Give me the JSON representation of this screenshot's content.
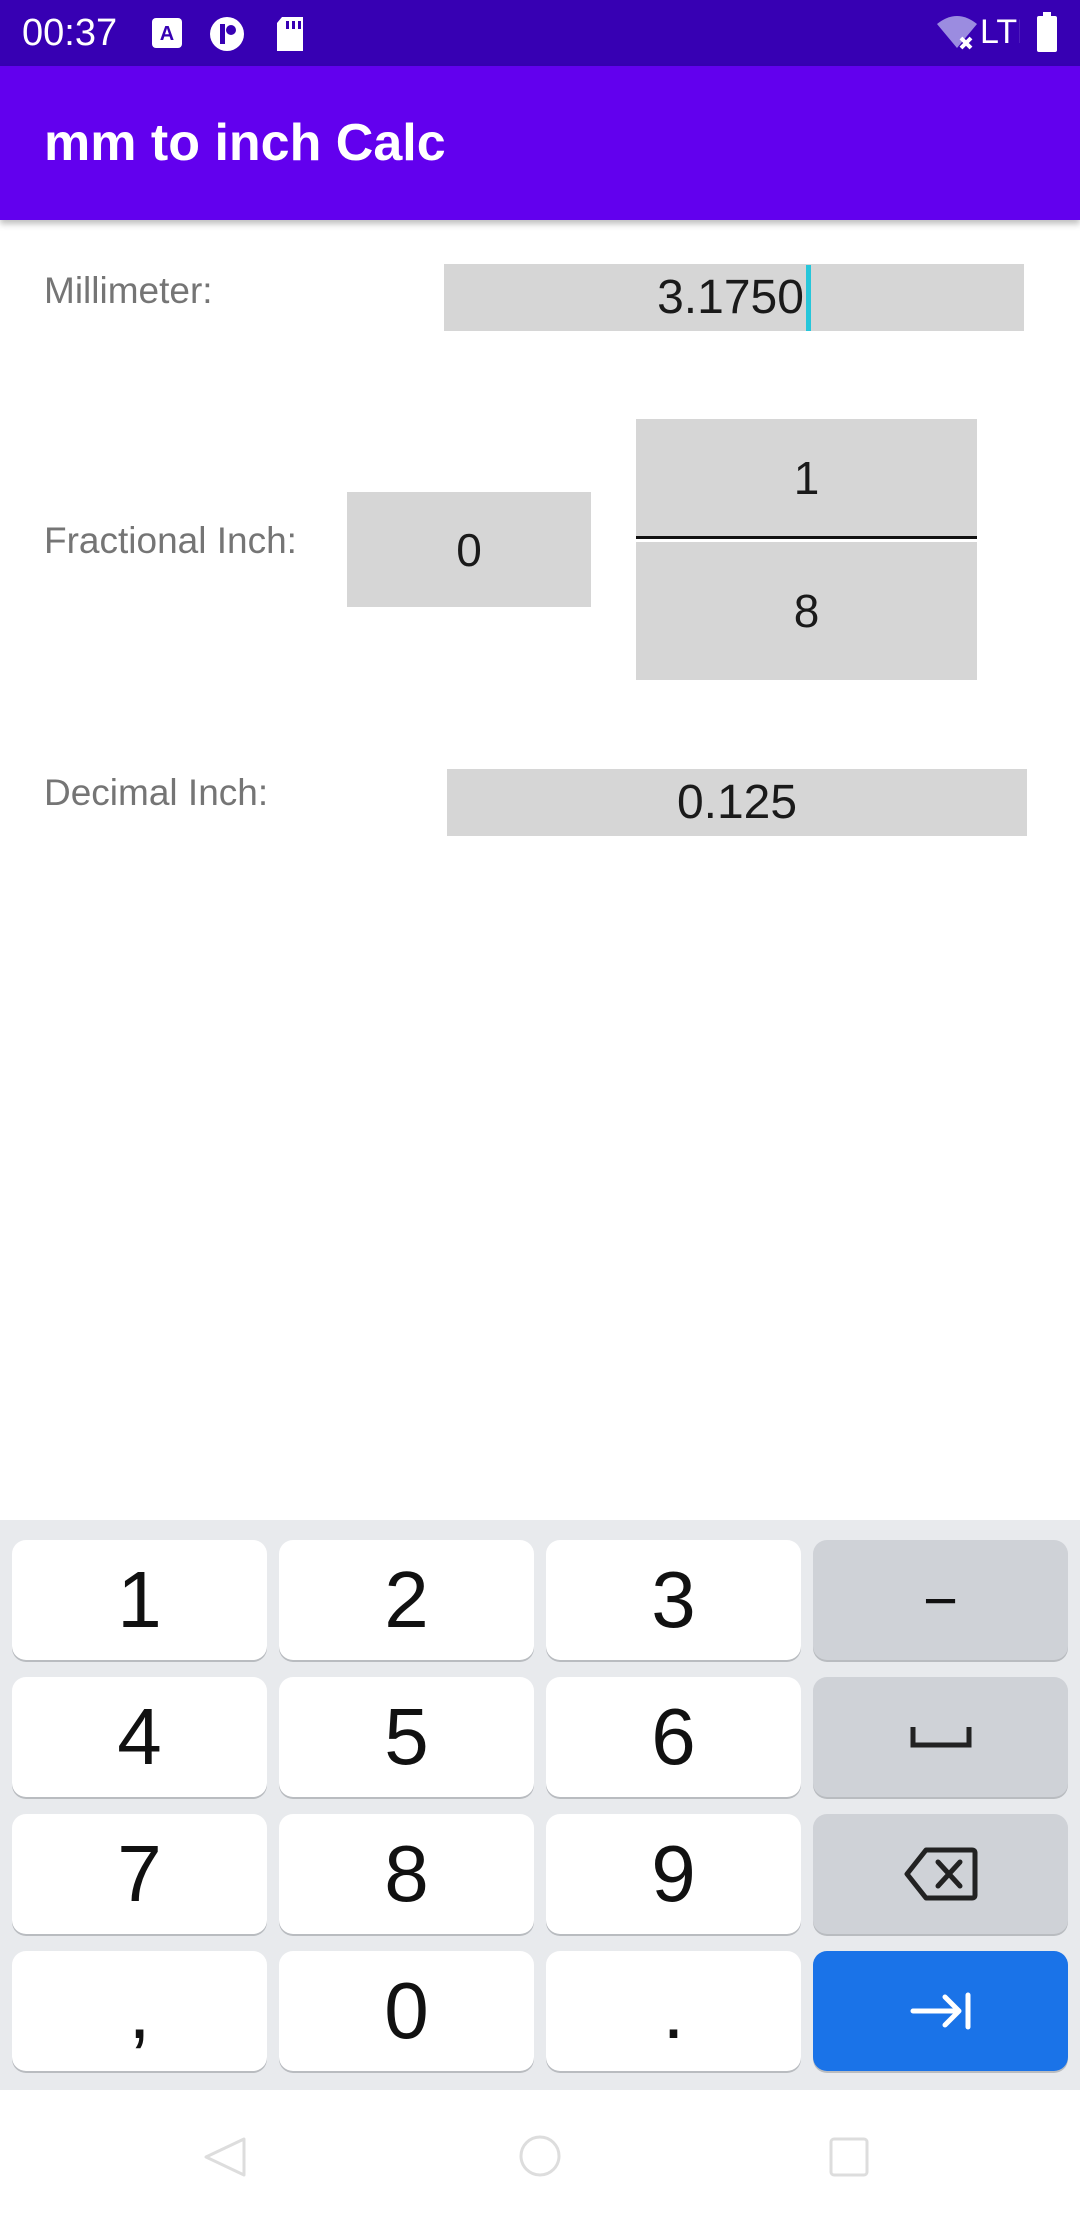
{
  "status_bar": {
    "time": "00:37",
    "network": "LTE",
    "icons": [
      "translate-icon",
      "app-badge-icon",
      "sd-card-icon",
      "wifi-off-icon",
      "battery-icon"
    ]
  },
  "app_bar": {
    "title": "mm to inch Calc",
    "color": "#6200ee"
  },
  "form": {
    "millimeter_label": "Millimeter:",
    "millimeter_value": "3.1750",
    "fractional_label": "Fractional Inch:",
    "whole_value": "0",
    "numerator_value": "1",
    "denominator_value": "8",
    "decimal_label": "Decimal Inch:",
    "decimal_value": "0.125"
  },
  "keyboard": {
    "keys": [
      "1",
      "2",
      "3",
      "−",
      "4",
      "5",
      "6",
      "␣",
      "7",
      "8",
      "9",
      "⌫",
      ",",
      "0",
      ".",
      "→|"
    ],
    "accent": "#1a73e8"
  },
  "nav_bar": {
    "icons": [
      "back-icon",
      "home-icon",
      "recents-icon"
    ]
  }
}
